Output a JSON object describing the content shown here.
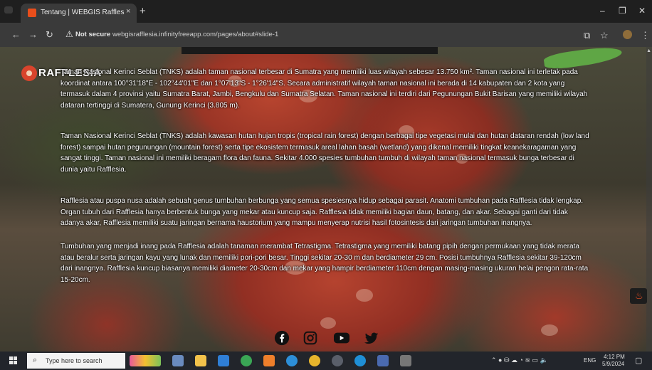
{
  "browser": {
    "tab_title": "Tentang | WEBGIS Rafflesia SP",
    "tab_close": "×",
    "new_tab": "+",
    "window_controls": {
      "minimize": "–",
      "maximize": "❐",
      "close": "✕"
    },
    "security_label": "Not secure",
    "url": "webgisrafflesia.infinityfreeapp.com/pages/about#slide-1"
  },
  "page": {
    "logo_text": "RAFFLESIA",
    "paragraphs": [
      "Taman Nasional Kerinci Seblat (TNKS) adalah taman nasional terbesar di Sumatra yang memiliki luas wilayah sebesar 13.750 km². Taman nasional ini terletak pada koordinat antara 100°31'18\"E - 102°44'01\"E dan 1°07'13\"S - 1°26'14\"S. Secara administratif wilayah taman nasional ini berada di 14 kabupaten dan 2 kota yang termasuk dalam 4 provinsi yaitu Sumatra Barat, Jambi, Bengkulu dan Sumatra Selatan. Taman nasional ini terdiri dari Pegunungan Bukit Barisan yang memiliki wilayah dataran tertinggi di Sumatera, Gunung Kerinci (3.805 m).",
      "Taman Nasional Kerinci Seblat (TNKS) adalah kawasan hutan hujan tropis (tropical rain forest) dengan berbagai tipe vegetasi mulai dan hutan dataran rendah (low land forest) sampai hutan pegunungan (mountain forest) serta tipe ekosistem termasuk areal lahan basah (wetland) yang dikenal memiliki tingkat keanekaragaman yang sangat tinggi. Taman nasional ini memiliki beragam flora dan fauna. Sekitar 4.000 spesies tumbuhan tumbuh di wilayah taman nasional termasuk bunga terbesar di dunia yaitu Rafflesia.",
      "Rafflesia atau puspa nusa adalah sebuah genus tumbuhan berbunga yang semua spesiesnya hidup sebagai parasit. Anatomi tumbuhan pada Rafflesia tidak lengkap. Organ tubuh dari Rafflesia hanya berbentuk bunga yang mekar atau kuncup saja. Rafflesia tidak memiliki bagian daun, batang, dan akar. Sebagai ganti dari tidak adanya akar, Rafflesia memiliki suatu jaringan bernama haustorium yang mampu menyerap nutrisi hasil fotosintesis dari jaringan tumbuhan inangnya.",
      "Tumbuhan yang menjadi inang pada Rafflesia adalah tanaman merambat Tetrastigma. Tetrastigma yang memiliki batang pipih dengan permukaan yang tidak merata atau beralur serta jaringan kayu yang lunak dan memiliki pori-pori besar. Tinggi sekitar 20-30 m dan berdiameter 29 cm. Posisi tumbuhnya Rafflesia sekitar 39-120cm dari inangnya. Rafflesia kuncup biasanya memiliki diameter 20-30cm dan mekar yang hampir berdiameter 110cm dengan masing-masing ukuran helai pengon rata-rata 15-20cm."
    ],
    "social": [
      "facebook-icon",
      "instagram-icon",
      "youtube-icon",
      "twitter-icon"
    ]
  },
  "taskbar": {
    "search_placeholder": "Type here to search",
    "language": "ENG",
    "time": "4:12 PM",
    "date": "5/9/2024"
  },
  "colors": {
    "accent": "#e94e1b",
    "taskbar": "#22252b",
    "toolbar": "#3a3a3a"
  }
}
